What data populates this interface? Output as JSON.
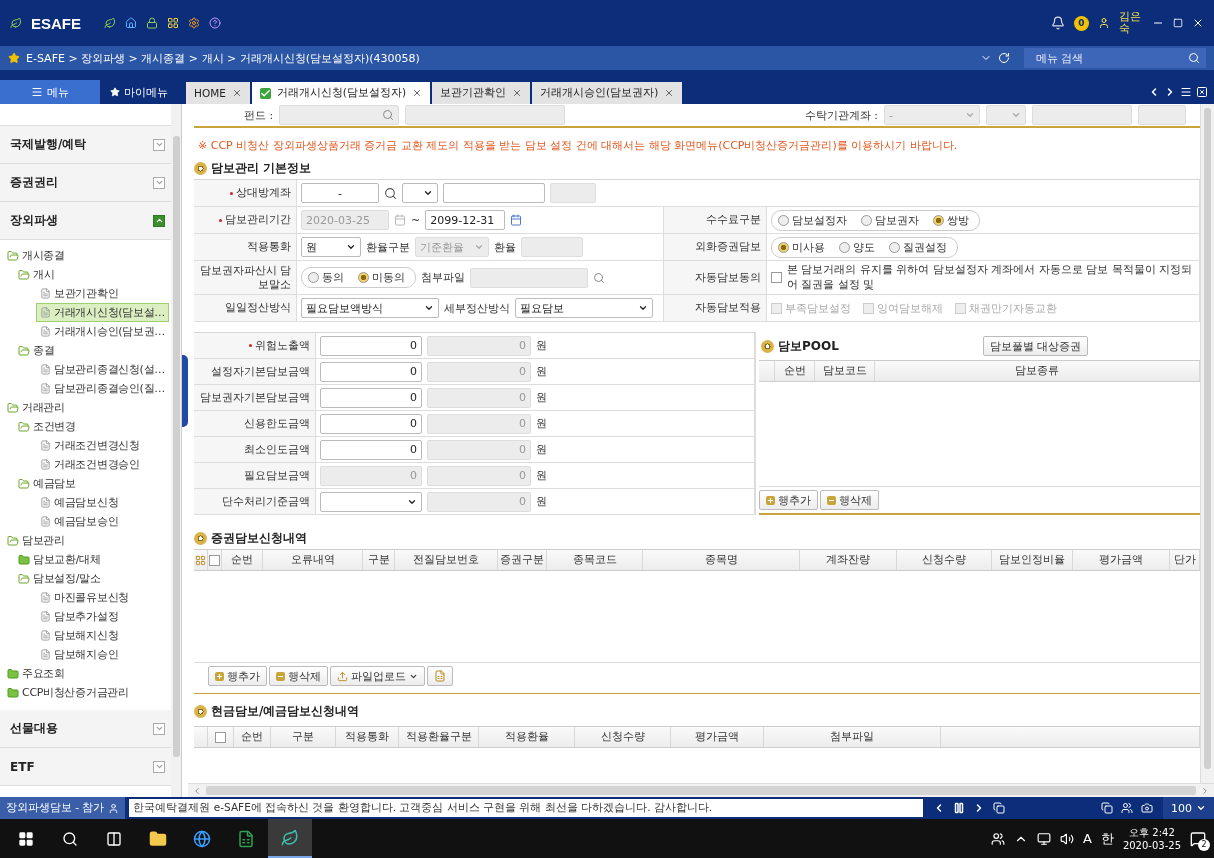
{
  "app": {
    "logo": "ESAFE",
    "notification_count": "0",
    "user": "김은숙"
  },
  "breadcrumb": "E-SAFE > 장외파생 > 개시종결 > 개시 > 거래개시신청(담보설정자)(430058)",
  "menu_search": {
    "placeholder": "메뉴 검색"
  },
  "menu_buttons": [
    {
      "label": "메뉴",
      "kind": "menu",
      "selected": true
    },
    {
      "label": "마이메뉴",
      "kind": "favorite",
      "selected": false
    }
  ],
  "tabs": [
    {
      "label": "HOME",
      "selected": false
    },
    {
      "label": "거래개시신청(담보설정자)",
      "selected": true
    },
    {
      "label": "보관기관확인",
      "selected": false
    },
    {
      "label": "거래개시승인(담보권자)",
      "selected": false
    }
  ],
  "sidebar": {
    "sections": [
      {
        "label": "국제발행/예탁",
        "expanded": false
      },
      {
        "label": "증권권리",
        "expanded": false
      },
      {
        "label": "장외파생",
        "expanded": true,
        "tree": [
          {
            "label": "개시종결",
            "kind": "folder",
            "expanded": true,
            "selected": false,
            "children": [
              {
                "label": "개시",
                "kind": "folder",
                "expanded": true,
                "selected": false,
                "children": [
                  {
                    "label": "보관기관확인",
                    "kind": "page",
                    "selected": false
                  },
                  {
                    "label": "거래개시신청(담보설…",
                    "kind": "page",
                    "selected": true
                  },
                  {
                    "label": "거래개시승인(담보권…",
                    "kind": "page",
                    "selected": false
                  }
                ]
              },
              {
                "label": "종결",
                "kind": "folder",
                "expanded": true,
                "selected": false,
                "children": [
                  {
                    "label": "담보관리종결신청(설…",
                    "kind": "page",
                    "selected": false
                  },
                  {
                    "label": "담보관리종결승인(질…",
                    "kind": "page",
                    "selected": false
                  }
                ]
              }
            ]
          },
          {
            "label": "거래관리",
            "kind": "folder",
            "expanded": true,
            "selected": false,
            "children": [
              {
                "label": "조건변경",
                "kind": "folder",
                "expanded": true,
                "selected": false,
                "children": [
                  {
                    "label": "거래조건변경신청",
                    "kind": "page",
                    "selected": false
                  },
                  {
                    "label": "거래조건변경승인",
                    "kind": "page",
                    "selected": false
                  }
                ]
              },
              {
                "label": "예금담보",
                "kind": "folder",
                "expanded": true,
                "selected": false,
                "children": [
                  {
                    "label": "예금담보신청",
                    "kind": "page",
                    "selected": false
                  },
                  {
                    "label": "예금담보승인",
                    "kind": "page",
                    "selected": false
                  }
                ]
              }
            ]
          },
          {
            "label": "담보관리",
            "kind": "folder",
            "expanded": true,
            "selected": false,
            "children": [
              {
                "label": "담보교환/대체",
                "kind": "folder",
                "expanded": false,
                "selected": false
              },
              {
                "label": "담보설정/말소",
                "kind": "folder",
                "expanded": true,
                "selected": false,
                "children": [
                  {
                    "label": "마진콜유보신청",
                    "kind": "page",
                    "selected": false
                  },
                  {
                    "label": "담보추가설정",
                    "kind": "page",
                    "selected": false
                  },
                  {
                    "label": "담보해지신청",
                    "kind": "page",
                    "selected": false
                  },
                  {
                    "label": "담보해지승인",
                    "kind": "page",
                    "selected": false
                  }
                ]
              }
            ]
          },
          {
            "label": "주요조회",
            "kind": "folder",
            "expanded": false,
            "selected": false
          },
          {
            "label": "CCP비청산증거금관리",
            "kind": "folder",
            "expanded": false,
            "selected": false
          }
        ]
      },
      {
        "label": "선물대용",
        "expanded": false
      },
      {
        "label": "ETF",
        "expanded": false
      }
    ]
  },
  "top_fields": {
    "fund_label": "펀드 :",
    "custody_label": "수탁기관계좌 :",
    "custody_value": "-"
  },
  "notice": "※ CCP 비청산 장외파생상품거래 증거금 교환 제도의 적용을 받는 담보 설정 건에 대해서는 해당 화면메뉴(CCP비청산증거금관리)를 이용하시기 바랍니다.",
  "basic_info": {
    "title": "담보관리 기본정보",
    "counterparty": {
      "label": "상대방계좌",
      "required": true,
      "value": "-"
    },
    "period": {
      "label": "담보관리기간",
      "required": true,
      "start": {
        "value": "2020-03-25",
        "disabled": true
      },
      "separator": "~",
      "end": {
        "value": "2099-12-31",
        "disabled": false
      }
    },
    "currency": {
      "label": "적용통화",
      "value": "원"
    },
    "rate_type": {
      "label": "환율구분",
      "value": "기준환율",
      "disabled": true
    },
    "rate": {
      "label": "환율"
    },
    "bankruptcy": {
      "label": "담보권자파산시 담보말소",
      "options": [
        {
          "label": "동의",
          "selected": false
        },
        {
          "label": "미동의",
          "selected": true
        }
      ]
    },
    "attachment": {
      "label": "첨부파일"
    },
    "daily_settlement": {
      "label": "일일정산방식",
      "value": "필요담보액방식"
    },
    "detail_settlement": {
      "label": "세부정산방식",
      "value": "필요담보"
    },
    "fee_type": {
      "label": "수수료구분",
      "options": [
        {
          "label": "담보설정자",
          "selected": false
        },
        {
          "label": "담보권자",
          "selected": false
        },
        {
          "label": "쌍방",
          "selected": true
        }
      ]
    },
    "fx_collateral": {
      "label": "외화증권담보",
      "options": [
        {
          "label": "미사용",
          "selected": true
        },
        {
          "label": "양도",
          "selected": false
        },
        {
          "label": "질권설정",
          "selected": false
        }
      ]
    },
    "auto_consent": {
      "label": "자동담보동의",
      "checked": false,
      "text": "본 담보거래의 유지를 위하여 담보설정자 계좌에서 자동으로 담보 목적물이 지정되어 질권을 설정 및"
    },
    "auto_apply": {
      "label": "자동담보적용",
      "options": [
        {
          "label": "부족담보설정",
          "checked": false,
          "disabled": true
        },
        {
          "label": "잉여담보해제",
          "checked": false,
          "disabled": true
        },
        {
          "label": "채권만기자동교환",
          "checked": false,
          "disabled": true
        }
      ]
    }
  },
  "amounts": [
    {
      "label": "위험노출액",
      "required": true,
      "kind": "input",
      "value": "0",
      "computed": "0",
      "unit": "원"
    },
    {
      "label": "설정자기본담보금액",
      "required": false,
      "kind": "input",
      "value": "0",
      "computed": "0",
      "unit": "원"
    },
    {
      "label": "담보권자기본담보금액",
      "required": false,
      "kind": "input",
      "value": "0",
      "computed": "0",
      "unit": "원"
    },
    {
      "label": "신용한도금액",
      "required": false,
      "kind": "input",
      "value": "0",
      "computed": "0",
      "unit": "원"
    },
    {
      "label": "최소인도금액",
      "required": false,
      "kind": "input",
      "value": "0",
      "computed": "0",
      "unit": "원"
    },
    {
      "label": "필요담보금액",
      "required": false,
      "kind": "readonly",
      "value": "0",
      "computed": "0",
      "unit": "원"
    },
    {
      "label": "단수처리기준금액",
      "required": false,
      "kind": "select",
      "computed": "0",
      "unit": "원"
    }
  ],
  "pool": {
    "title": "담보POOL",
    "button": "담보풀별 대상증권",
    "columns": [
      "순번",
      "담보코드",
      "담보종류"
    ],
    "actions": [
      {
        "label": "행추가",
        "kind": "add"
      },
      {
        "label": "행삭제",
        "kind": "delete"
      }
    ]
  },
  "securities": {
    "title": "증권담보신청내역",
    "all_checked": false,
    "columns": [
      "순번",
      "오류내역",
      "구분",
      "전질담보번호",
      "증권구분",
      "종목코드",
      "종목명",
      "계좌잔량",
      "신청수량",
      "담보인정비율",
      "평가금액",
      "단가"
    ],
    "actions": [
      {
        "label": "행추가",
        "kind": "add"
      },
      {
        "label": "행삭제",
        "kind": "delete"
      },
      {
        "label": "파일업로드",
        "kind": "upload"
      },
      {
        "kind": "excel"
      }
    ]
  },
  "cash": {
    "title": "현금담보/예금담보신청내역",
    "all_checked": false,
    "columns": [
      "순번",
      "구분",
      "적용통화",
      "적용환율구분",
      "적용환율",
      "신청수량",
      "평가금액",
      "첨부파일"
    ]
  },
  "status_bar": {
    "screen": "장외파생담보 - 참가",
    "message": "한국예탁결제원 e-SAFE에 접속하신 것을 환영합니다. 고객중심 서비스 구현을 위해 최선을 다하겠습니다. 감사합니다.",
    "zoom": "100"
  },
  "taskbar": {
    "ime": "A",
    "lang": "한",
    "time": "오후 2:42",
    "date": "2020-03-25",
    "notifications": "2"
  }
}
